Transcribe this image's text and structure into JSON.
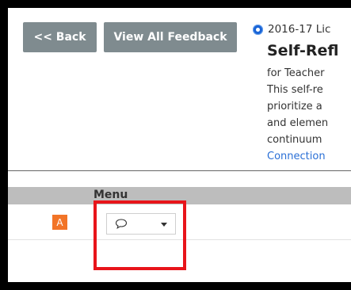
{
  "toolbar": {
    "back_label": "<< Back",
    "view_all_label": "View All Feedback"
  },
  "document": {
    "status_icon": "radio-dot-icon",
    "year_title": "2016-17 Lic",
    "title": "Self-Refl",
    "description_lines": [
      "for Teacher",
      "This self-re",
      "prioritize a",
      "and elemen",
      "continuum"
    ],
    "link_text": "Connection"
  },
  "table": {
    "menu_header": "Menu",
    "row": {
      "badge": "A",
      "menu_icon": "speech-bubble-icon",
      "dropdown_icon": "caret-down-icon"
    }
  },
  "colors": {
    "button_bg": "#7f8b8f",
    "badge_bg": "#f27427",
    "link": "#2a6fd6",
    "highlight": "#e8141a",
    "header_bg": "#bdbdbd"
  }
}
